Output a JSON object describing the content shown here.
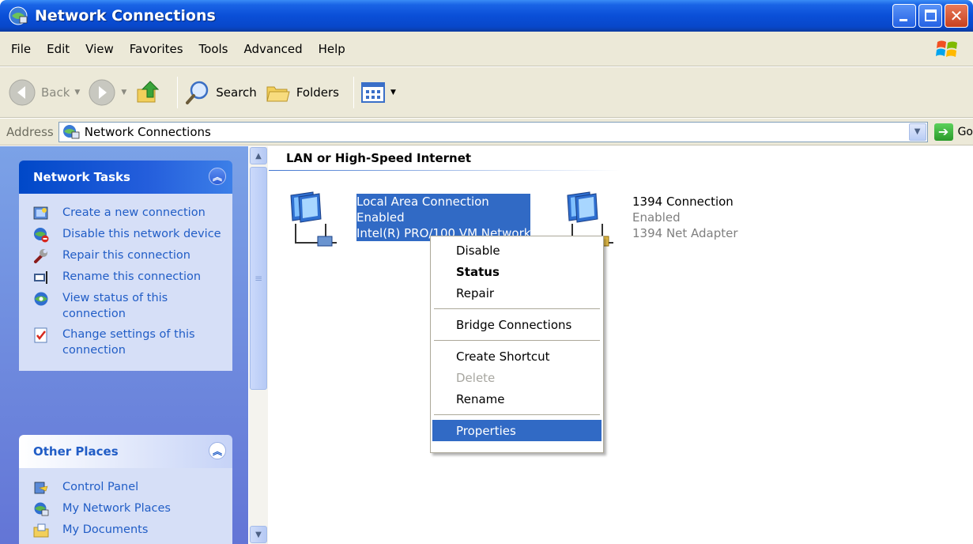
{
  "window": {
    "title": "Network Connections"
  },
  "menubar": {
    "items": [
      "File",
      "Edit",
      "View",
      "Favorites",
      "Tools",
      "Advanced",
      "Help"
    ]
  },
  "toolbar": {
    "back_label": "Back",
    "search_label": "Search",
    "folders_label": "Folders"
  },
  "address": {
    "label": "Address",
    "value": "Network Connections",
    "go_label": "Go"
  },
  "network_tasks": {
    "title": "Network Tasks",
    "items": [
      {
        "label": "Create a new connection",
        "icon": "new-connection-icon"
      },
      {
        "label": "Disable this network device",
        "icon": "disable-device-icon"
      },
      {
        "label": "Repair this connection",
        "icon": "repair-wrench-icon"
      },
      {
        "label": "Rename this connection",
        "icon": "rename-icon"
      },
      {
        "label": "View status of this connection",
        "icon": "view-status-icon"
      },
      {
        "label": "Change settings of this connection",
        "icon": "change-settings-icon"
      }
    ]
  },
  "other_places": {
    "title": "Other Places",
    "items": [
      {
        "label": "Control Panel",
        "icon": "control-panel-icon"
      },
      {
        "label": "My Network Places",
        "icon": "network-places-icon"
      },
      {
        "label": "My Documents",
        "icon": "my-documents-icon"
      }
    ]
  },
  "content": {
    "group_title": "LAN or High-Speed Internet",
    "connections": [
      {
        "name": "Local Area Connection",
        "status": "Enabled",
        "adapter": "Intel(R) PRO/100 VM Network"
      },
      {
        "name": "1394 Connection",
        "status": "Enabled",
        "adapter": "1394 Net Adapter"
      }
    ]
  },
  "context_menu": {
    "disable": "Disable",
    "status": "Status",
    "repair": "Repair",
    "bridge": "Bridge Connections",
    "shortcut": "Create Shortcut",
    "delete": "Delete",
    "rename": "Rename",
    "properties": "Properties"
  },
  "colors": {
    "title_blue": "#0a4fd8",
    "selection": "#316ac5",
    "link_blue": "#215dc6",
    "pane_blue": "#6375d6"
  }
}
